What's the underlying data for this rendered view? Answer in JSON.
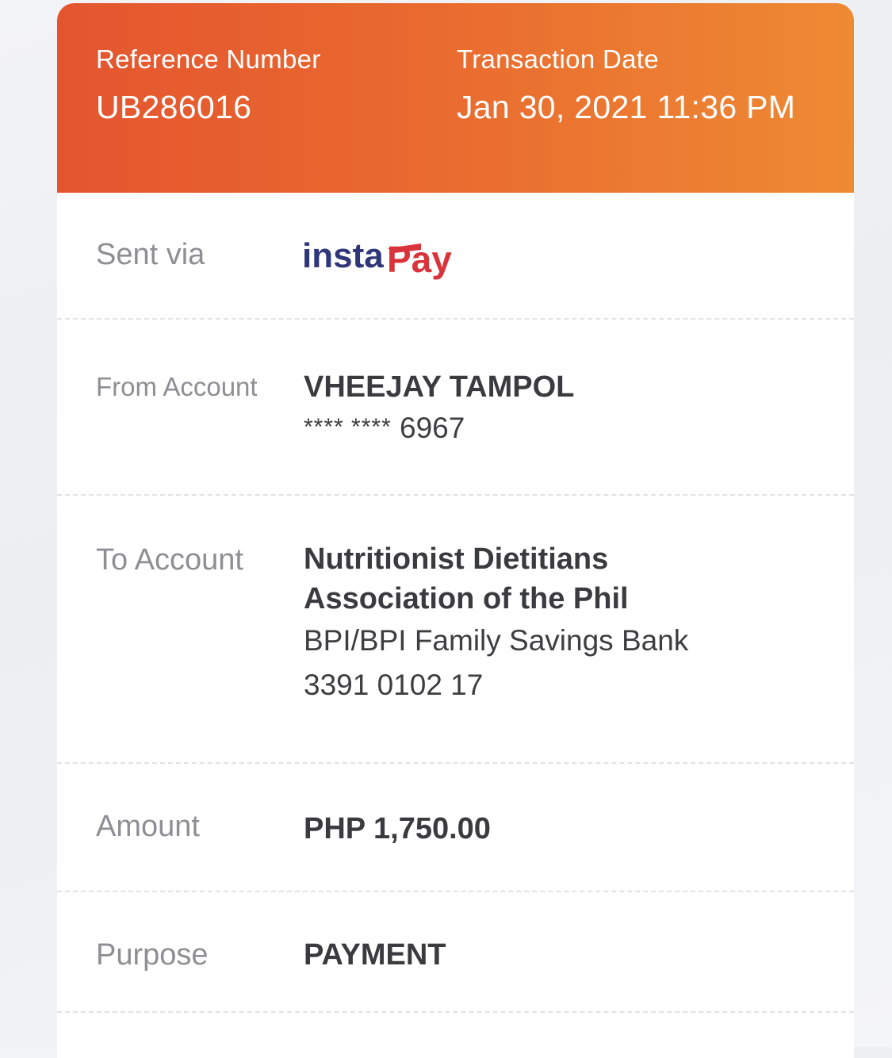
{
  "header": {
    "reference_label": "Reference Number",
    "reference_value": "UB286016",
    "date_label": "Transaction Date",
    "date_value": "Jan 30, 2021 11:36 PM",
    "gradient_start": "#e4552f",
    "gradient_end": "#ee8a33"
  },
  "sent_via": {
    "label": "Sent via",
    "logo_name": "instapay-logo",
    "logo_text_insta": "insta",
    "logo_text_pay": "Pay",
    "logo_colors": {
      "insta": "#2f3778",
      "pay": "#d9343b"
    }
  },
  "from_account": {
    "label": "From Account",
    "name": "VHEEJAY TAMPOL",
    "masked_prefix": "**** ****",
    "last_digits": "6967"
  },
  "to_account": {
    "label": "To Account",
    "name_line1": "Nutritionist Dietitians",
    "name_line2": "Association of the Phil",
    "bank": "BPI/BPI Family Savings Bank",
    "account_number": "3391 0102 17"
  },
  "amount": {
    "label": "Amount",
    "value": "PHP 1,750.00"
  },
  "purpose": {
    "label": "Purpose",
    "value": "PAYMENT"
  }
}
